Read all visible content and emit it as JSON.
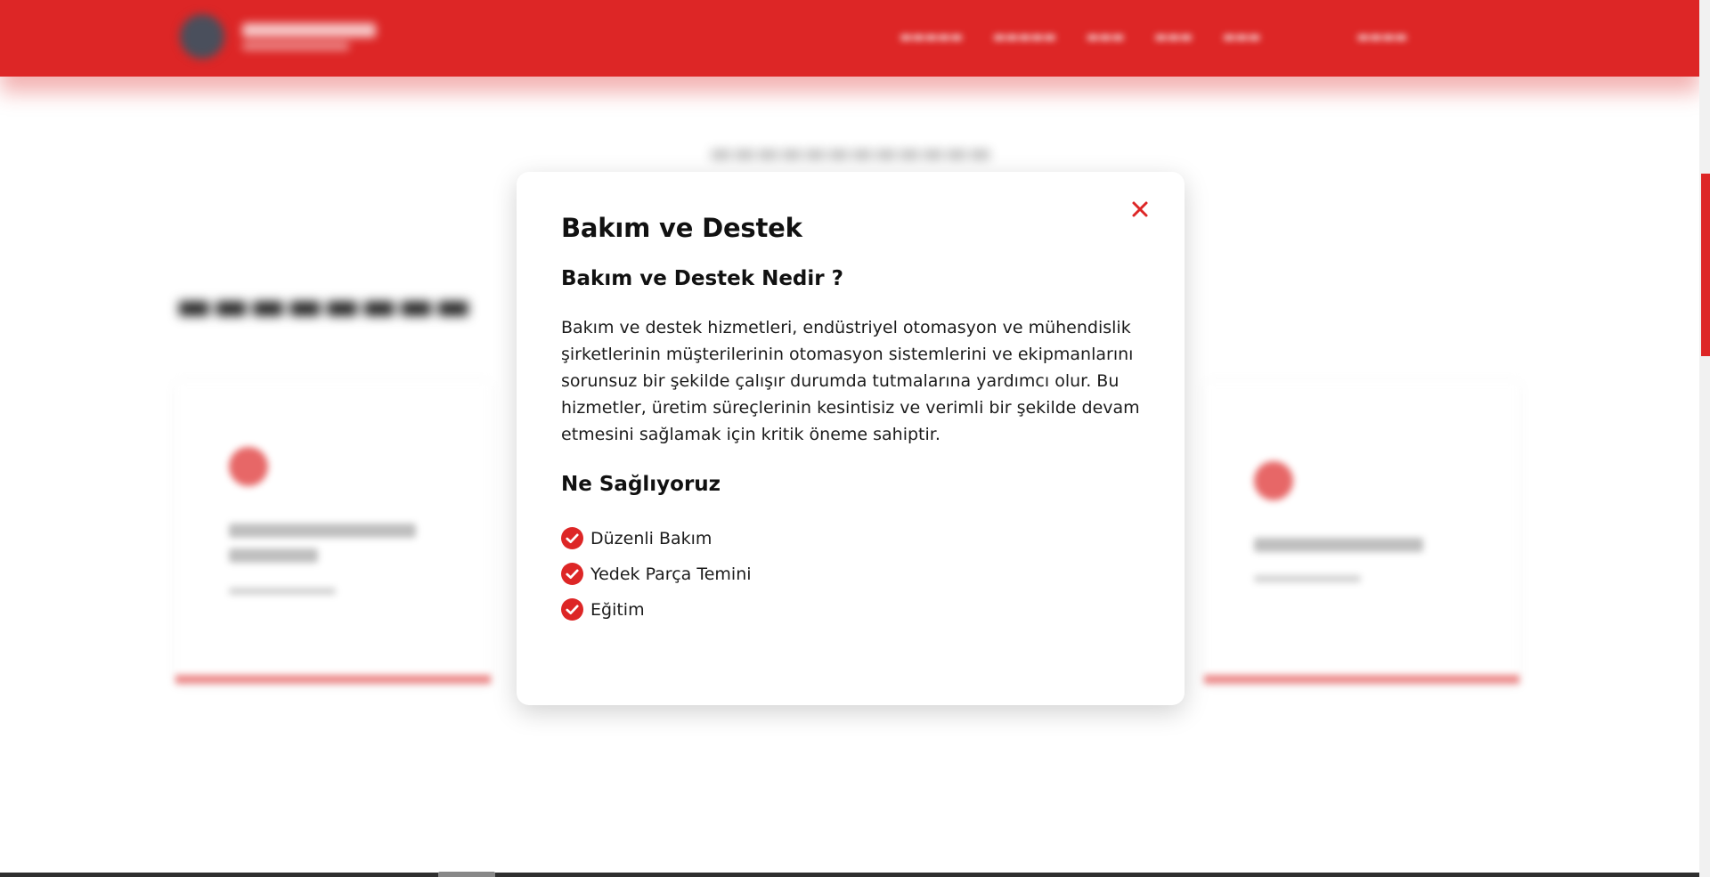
{
  "colors": {
    "accent": "#dd2626",
    "modal_background": "#ffffff",
    "text": "#161616"
  },
  "modal": {
    "title": "Bakım ve Destek",
    "subtitle": "Bakım ve Destek Nedir ?",
    "description": "Bakım ve destek hizmetleri, endüstriyel otomasyon ve mühendislik şirketlerinin müşterilerinin otomasyon sistemlerini ve ekipmanlarını sorunsuz bir şekilde çalışır durumda tutmalarına yardımcı olur. Bu hizmetler, üretim süreçlerinin kesintisiz ve verimli bir şekilde devam etmesini sağlamak için kritik öneme sahiptir.",
    "section_title": "Ne Sağlıyoruz",
    "features": [
      {
        "label": "Düzenli Bakım",
        "icon": "check-circle-icon"
      },
      {
        "label": "Yedek Parça Temini",
        "icon": "check-circle-icon"
      },
      {
        "label": "Eğitim",
        "icon": "check-circle-icon"
      }
    ],
    "close_icon": "close-icon"
  }
}
